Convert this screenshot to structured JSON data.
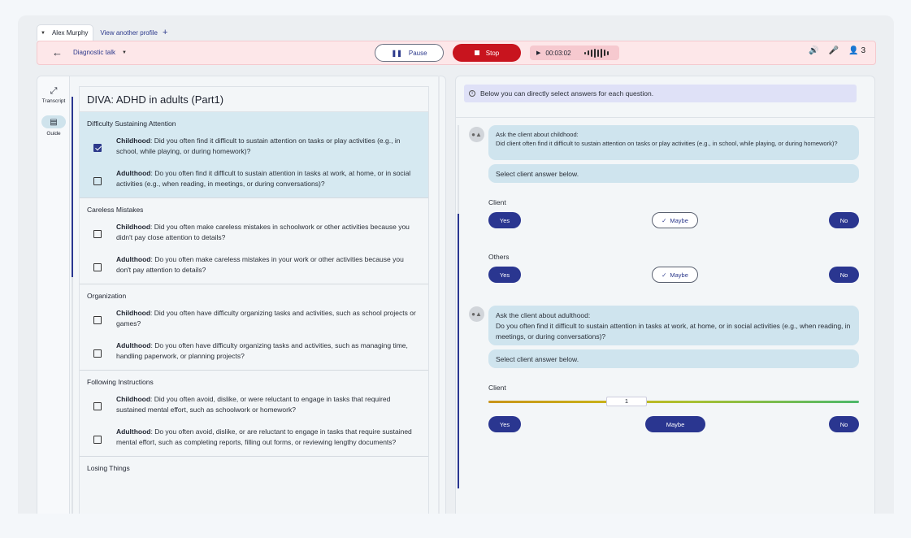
{
  "profile_bar": {
    "profile_name": "Alex Murphy",
    "view_another": "View another profile",
    "add_icon": "+"
  },
  "toolbar": {
    "mode_label": "Diagnostic talk",
    "pause_label": "Pause",
    "stop_label": "Stop",
    "timer": "00:03:02",
    "participants": "3",
    "colors": {
      "bar_bg": "#fde7e9",
      "stop": "#c8141e",
      "accent": "#2d3a8c"
    }
  },
  "rail": {
    "transcript_label": "Transcript",
    "guide_label": "Guide"
  },
  "guide": {
    "title": "DIVA: ADHD in adults (Part1)",
    "sections": [
      {
        "name": "Difficulty Sustaining Attention",
        "items": [
          {
            "label": "Childhood",
            "text": ": Did you often find it difficult to sustain attention on tasks or play activities (e.g., in school, while playing, or during homework)?",
            "checked": true
          },
          {
            "label": "Adulthood",
            "text": ": Do you often find it difficult to sustain attention in tasks at work, at home, or in social activities (e.g., when reading, in meetings, or during conversations)?",
            "checked": false
          }
        ]
      },
      {
        "name": "Careless Mistakes",
        "items": [
          {
            "label": "Childhood",
            "text": ": Did you often make careless mistakes in schoolwork or other activities because you didn't pay close attention to details?",
            "checked": false
          },
          {
            "label": "Adulthood",
            "text": ": Do you often make careless mistakes in your work or other activities because you don't pay attention to details?",
            "checked": false
          }
        ]
      },
      {
        "name": "Organization",
        "items": [
          {
            "label": "Childhood",
            "text": ": Did you often have difficulty organizing tasks and activities, such as school projects or games?",
            "checked": false
          },
          {
            "label": "Adulthood",
            "text": ": Do you often have difficulty organizing tasks and activities, such as managing time, handling paperwork, or planning projects?",
            "checked": false
          }
        ]
      },
      {
        "name": "Following Instructions",
        "items": [
          {
            "label": "Childhood",
            "text": ": Did you often avoid, dislike, or were reluctant to engage in tasks that required sustained mental effort, such as schoolwork or homework?",
            "checked": false
          },
          {
            "label": "Adulthood",
            "text": ": Do you often avoid, dislike, or are reluctant to engage in tasks that require sustained mental effort, such as completing reports, filling out forms, or reviewing lengthy documents?",
            "checked": false
          }
        ]
      },
      {
        "name": "Losing Things",
        "items": []
      }
    ]
  },
  "answers": {
    "info": "Below you can directly select answers for each question.",
    "q1": {
      "prompt_line1": "Ask the client about childhood:",
      "prompt_line2": "Did client often find it difficult to sustain attention on tasks or play activities (e.g., in school, while playing, or during homework)?",
      "select_hint": "Select client answer below.",
      "client_label": "Client",
      "others_label": "Others",
      "yes": "Yes",
      "maybe": "Maybe",
      "no": "No",
      "client_selected": "Maybe",
      "others_selected": "Maybe"
    },
    "q2": {
      "prompt_line1": "Ask the client about adulthood:",
      "prompt_line2": "Do you often find it difficult to sustain attention in tasks at work, at home, or in social activities (e.g., when reading, in meetings, or during conversations)?",
      "select_hint": "Select client answer below.",
      "client_label": "Client",
      "slider_value": "1",
      "yes": "Yes",
      "maybe": "Maybe",
      "no": "No"
    }
  }
}
